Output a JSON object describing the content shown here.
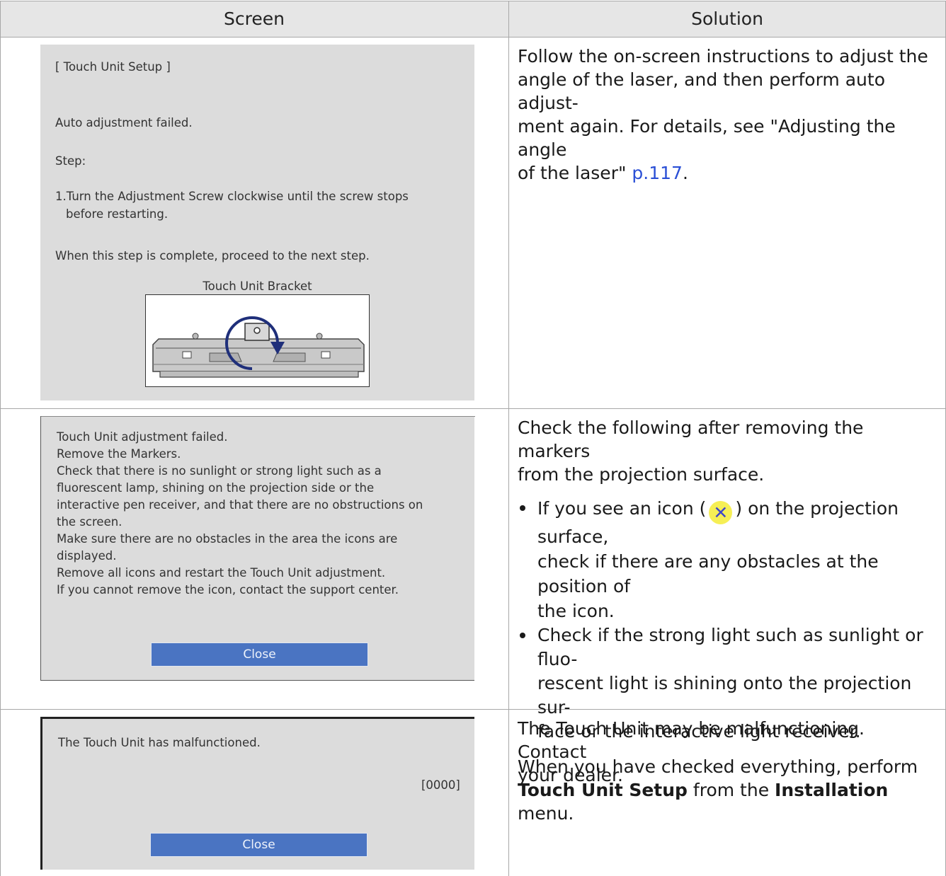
{
  "header": {
    "screen": "Screen",
    "solution": "Solution"
  },
  "row1": {
    "screen": {
      "title": "[ Touch Unit Setup ]",
      "msg": "Auto adjustment failed.",
      "step": "Step:",
      "step1_a": "1.Turn the Adjustment Screw clockwise until the screw stops",
      "step1_b": "before restarting.",
      "next": "When this step is complete, proceed to the next step.",
      "caption": "Touch Unit Bracket"
    },
    "solution": {
      "l1": "Follow the on-screen instructions to adjust the",
      "l2": "angle of the laser, and then perform auto adjust-",
      "l3": "ment again. For details, see \"Adjusting the angle",
      "l4": "of the laser\" ",
      "link": "p.117",
      "l4_end": "."
    }
  },
  "row2": {
    "screen": {
      "lines": [
        "Touch Unit adjustment failed.",
        "Remove the Markers.",
        "Check that there is no sunlight or strong light such as a",
        "fluorescent lamp, shining on the projection side or the",
        "interactive pen receiver, and that there are no obstructions on",
        "the screen.",
        "Make sure there are no obstacles in the area the icons are",
        "displayed.",
        "Remove all icons and restart the Touch Unit adjustment.",
        "If you cannot remove the icon, contact the support center."
      ],
      "close": "Close"
    },
    "solution": {
      "intro_1": "Check the following after removing the markers",
      "intro_2": "from the projection surface.",
      "b1_a": "If you see an icon (",
      "b1_icon": "✕",
      "b1_b": ") on the projection surface,",
      "b1_c": "check if there are any obstacles at the position of",
      "b1_d": "the icon.",
      "b2_a": "Check if the strong light such as sunlight or fluo-",
      "b2_b": "rescent light is shining onto the projection sur-",
      "b2_c": "face or the interactive light receiver.",
      "end_1": "When you have checked everything, perform",
      "end_bold1": "Touch Unit Setup",
      "end_mid": " from the ",
      "end_bold2": "Installation",
      "end_tail": " menu."
    }
  },
  "row3": {
    "screen": {
      "msg": "The Touch Unit has malfunctioned.",
      "code": "[0000]",
      "close": "Close"
    },
    "solution": {
      "l1": "The Touch Unit may be malfunctioning. Contact",
      "l2": "your dealer."
    }
  },
  "icons": {
    "rotate_arrow": "rotate-clockwise-icon",
    "x_badge": "close-x-icon"
  },
  "colors": {
    "header_bg": "#e6e6e6",
    "screen_bg": "#dcdcdc",
    "close_button": "#4a74c2",
    "link": "#2a4fd6",
    "x_badge_bg": "#f6ef55"
  }
}
